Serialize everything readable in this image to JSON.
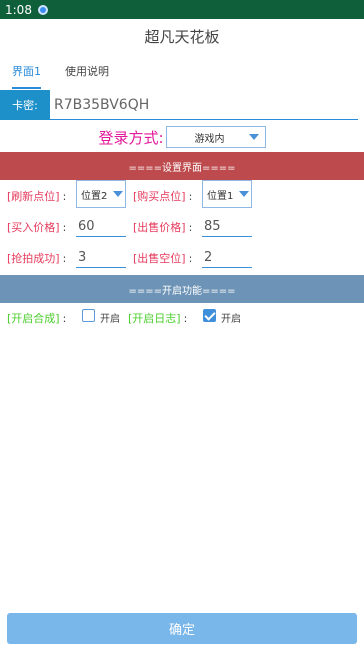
{
  "status": {
    "time": "1:08"
  },
  "title": "超凡天花板",
  "tabs": [
    {
      "label": "界面1"
    },
    {
      "label": "使用说明"
    }
  ],
  "key": {
    "label": "卡密:",
    "value": "R7B35BV6QH"
  },
  "login": {
    "label": "登录方式:",
    "selected": "游戏内"
  },
  "settings_banner": "====设置界面====",
  "settings": {
    "refresh_label": "[刷新点位]",
    "refresh_value": "位置2",
    "buy_point_label": "[购买点位]",
    "buy_point_value": "位置1",
    "buy_price_label": "[买入价格]",
    "buy_price_value": "60",
    "sell_price_label": "[出售价格]",
    "sell_price_value": "85",
    "grab_success_label": "[抢拍成功]",
    "grab_success_value": "3",
    "sell_slots_label": "[出售空位]",
    "sell_slots_value": "2",
    "colon": ":"
  },
  "features_banner": "====开启功能====",
  "features": {
    "combine_label": "[开启合成]",
    "combine_text": "开启",
    "combine_checked": false,
    "log_label": "[开启日志]",
    "log_text": "开启",
    "log_checked": true,
    "colon": ":"
  },
  "confirm_label": "确定",
  "colors": {
    "accent": "#1e90c9",
    "red_banner": "#bd4a4c",
    "blue_banner": "#6d94b6",
    "label_pink": "#e63a5c",
    "label_green": "#4ccd2e",
    "login_magenta": "#e2189a"
  }
}
